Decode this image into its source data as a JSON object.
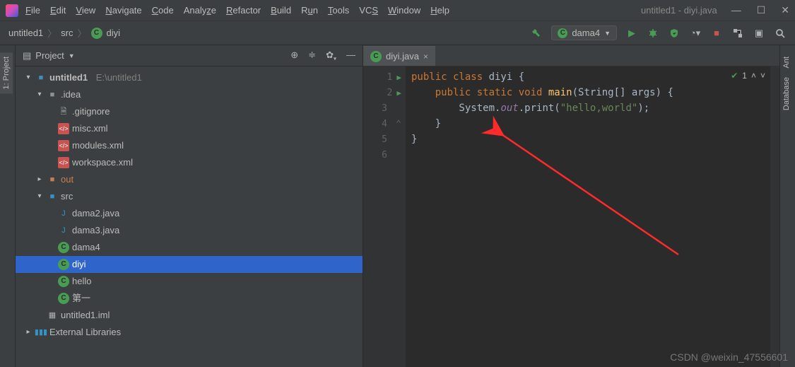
{
  "window_title": "untitled1 - diyi.java",
  "menu": [
    "File",
    "Edit",
    "View",
    "Navigate",
    "Code",
    "Analyze",
    "Refactor",
    "Build",
    "Run",
    "Tools",
    "VCS",
    "Window",
    "Help"
  ],
  "breadcrumb": {
    "root": "untitled1",
    "folder": "src",
    "file": "diyi"
  },
  "run_config": "dama4",
  "panel": {
    "title": "Project"
  },
  "tree": {
    "project": "untitled1",
    "project_path": "E:\\untitled1",
    "idea": ".idea",
    "gitignore": ".gitignore",
    "misc": "misc.xml",
    "modules": "modules.xml",
    "workspace": "workspace.xml",
    "out": "out",
    "src": "src",
    "files": [
      "dama2.java",
      "dama3.java",
      "dama4",
      "diyi",
      "hello",
      "第一"
    ],
    "iml": "untitled1.iml",
    "extlib": "External Libraries"
  },
  "tab": "diyi.java",
  "gutter": [
    "1",
    "2",
    "3",
    "4",
    "5",
    "6"
  ],
  "code_status": "1",
  "code": {
    "l1": {
      "a": "public class ",
      "b": "diyi ",
      "c": "{"
    },
    "l2": {
      "a": "    public static void ",
      "b": "main",
      "c": "(String[] args) {"
    },
    "l3": {
      "a": "        System.",
      "b": "out",
      "c": ".print(",
      "d": "\"hello,world\"",
      "e": ");"
    },
    "l4": "    }",
    "l5": "}",
    "l6": ""
  },
  "sidebars": {
    "left": "1: Project",
    "right_ant": "Ant",
    "right_db": "Database"
  },
  "watermark": "CSDN @weixin_47556601"
}
